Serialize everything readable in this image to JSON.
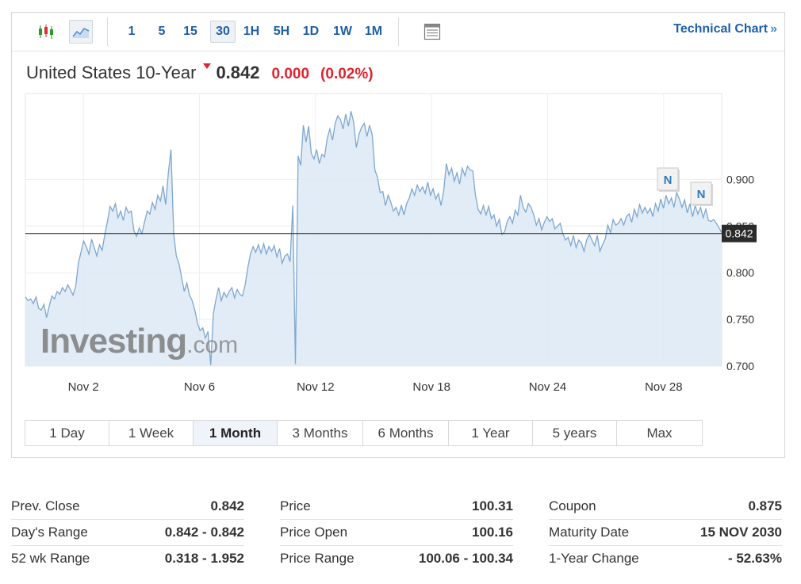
{
  "toolbar": {
    "timeframes": [
      "1",
      "5",
      "15",
      "30",
      "1H",
      "5H",
      "1D",
      "1W",
      "1M"
    ],
    "active_timeframe": "30",
    "technical_chart_label": "Technical Chart",
    "technical_chart_arrow": "»"
  },
  "header": {
    "instrument": "United States 10-Year",
    "last": "0.842",
    "change": "0.000",
    "change_pct": "(0.02%)"
  },
  "watermark": {
    "brand": "Investing",
    "domain": ".com"
  },
  "chart_data": {
    "type": "area",
    "x_ticks": [
      "Nov 2",
      "Nov 6",
      "Nov 12",
      "Nov 18",
      "Nov 24",
      "Nov 28"
    ],
    "y_ticks": [
      "0.900",
      "0.850",
      "0.800",
      "0.750",
      "0.700"
    ],
    "ylim": [
      0.7,
      0.992
    ],
    "current_value": 0.842,
    "current_label": "0.842",
    "news_markers": [
      "N",
      "N"
    ],
    "grid": true,
    "series": [
      {
        "values": [
          0.774,
          0.77,
          0.772,
          0.767,
          0.774,
          0.762,
          0.76,
          0.766,
          0.752,
          0.764,
          0.775,
          0.772,
          0.78,
          0.777,
          0.784,
          0.78,
          0.787,
          0.782,
          0.776,
          0.785,
          0.81,
          0.822,
          0.834,
          0.828,
          0.82,
          0.836,
          0.827,
          0.818,
          0.83,
          0.824,
          0.841,
          0.855,
          0.871,
          0.866,
          0.874,
          0.859,
          0.866,
          0.856,
          0.87,
          0.864,
          0.866,
          0.845,
          0.839,
          0.848,
          0.842,
          0.854,
          0.866,
          0.863,
          0.875,
          0.868,
          0.883,
          0.877,
          0.893,
          0.873,
          0.907,
          0.932,
          0.842,
          0.818,
          0.81,
          0.795,
          0.78,
          0.789,
          0.776,
          0.77,
          0.76,
          0.746,
          0.738,
          0.741,
          0.73,
          0.737,
          0.701,
          0.756,
          0.772,
          0.784,
          0.77,
          0.779,
          0.774,
          0.78,
          0.784,
          0.773,
          0.782,
          0.777,
          0.775,
          0.787,
          0.805,
          0.82,
          0.828,
          0.822,
          0.83,
          0.821,
          0.831,
          0.82,
          0.828,
          0.823,
          0.829,
          0.817,
          0.826,
          0.81,
          0.818,
          0.82,
          0.812,
          0.872,
          0.702,
          0.925,
          0.915,
          0.958,
          0.94,
          0.957,
          0.928,
          0.922,
          0.932,
          0.917,
          0.927,
          0.924,
          0.944,
          0.954,
          0.942,
          0.96,
          0.968,
          0.964,
          0.954,
          0.97,
          0.957,
          0.973,
          0.961,
          0.934,
          0.948,
          0.956,
          0.96,
          0.946,
          0.958,
          0.948,
          0.91,
          0.902,
          0.886,
          0.887,
          0.872,
          0.883,
          0.876,
          0.866,
          0.87,
          0.862,
          0.872,
          0.862,
          0.874,
          0.88,
          0.89,
          0.883,
          0.894,
          0.887,
          0.892,
          0.885,
          0.897,
          0.883,
          0.89,
          0.879,
          0.885,
          0.872,
          0.888,
          0.917,
          0.905,
          0.912,
          0.898,
          0.907,
          0.895,
          0.912,
          0.904,
          0.914,
          0.91,
          0.909,
          0.883,
          0.868,
          0.863,
          0.872,
          0.862,
          0.871,
          0.858,
          0.862,
          0.85,
          0.857,
          0.841,
          0.844,
          0.855,
          0.86,
          0.853,
          0.867,
          0.862,
          0.883,
          0.87,
          0.865,
          0.874,
          0.87,
          0.862,
          0.851,
          0.858,
          0.846,
          0.854,
          0.86,
          0.855,
          0.858,
          0.847,
          0.85,
          0.853,
          0.842,
          0.835,
          0.838,
          0.829,
          0.84,
          0.827,
          0.835,
          0.832,
          0.823,
          0.835,
          0.841,
          0.835,
          0.829,
          0.84,
          0.823,
          0.83,
          0.836,
          0.851,
          0.843,
          0.857,
          0.851,
          0.853,
          0.858,
          0.851,
          0.86,
          0.863,
          0.854,
          0.868,
          0.86,
          0.873,
          0.864,
          0.87,
          0.864,
          0.869,
          0.86,
          0.874,
          0.866,
          0.879,
          0.869,
          0.883,
          0.874,
          0.88,
          0.87,
          0.886,
          0.879,
          0.87,
          0.878,
          0.864,
          0.874,
          0.86,
          0.872,
          0.863,
          0.87,
          0.859,
          0.868,
          0.856,
          0.855,
          0.857,
          0.853,
          0.848,
          0.843
        ]
      }
    ]
  },
  "ranges": [
    "1 Day",
    "1 Week",
    "1 Month",
    "3 Months",
    "6 Months",
    "1 Year",
    "5 years",
    "Max"
  ],
  "active_range": "1 Month",
  "stats": [
    [
      {
        "label": "Prev. Close",
        "value": "0.842"
      },
      {
        "label": "Day's Range",
        "value": "0.842 - 0.842"
      },
      {
        "label": "52 wk Range",
        "value": "0.318 - 1.952"
      }
    ],
    [
      {
        "label": "Price",
        "value": "100.31"
      },
      {
        "label": "Price Open",
        "value": "100.16"
      },
      {
        "label": "Price Range",
        "value": "100.06 - 100.34"
      }
    ],
    [
      {
        "label": "Coupon",
        "value": "0.875"
      },
      {
        "label": "Maturity Date",
        "value": "15 NOV 2030"
      },
      {
        "label": "1-Year Change",
        "value": "- 52.63%"
      }
    ]
  ]
}
